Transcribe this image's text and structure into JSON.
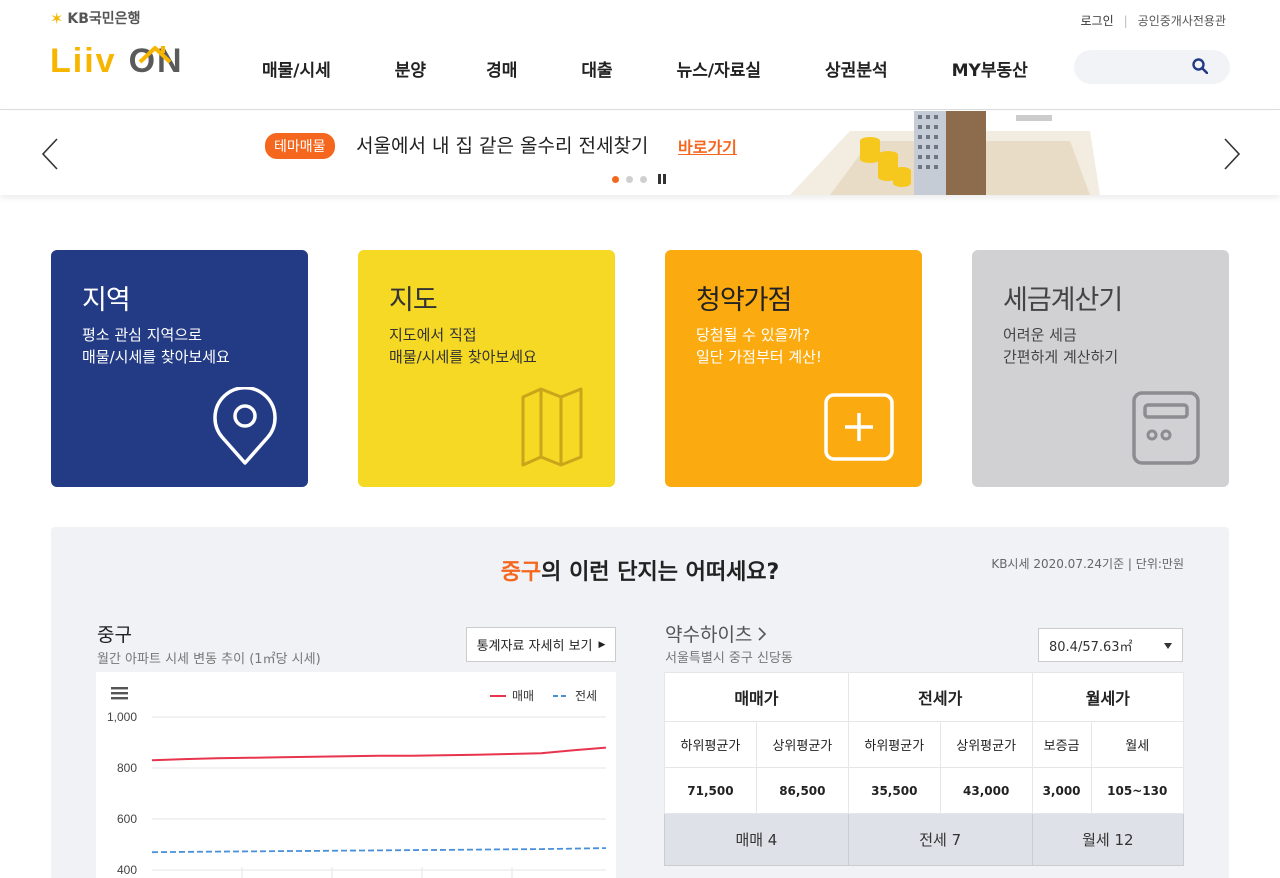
{
  "header": {
    "kb_logo_text": "KB국민은행",
    "logo_word_1": "Liiv",
    "logo_word_2": "ON",
    "login": "로그인",
    "broker_link": "공인중개사전용관",
    "nav": [
      "매물/시세",
      "분양",
      "경매",
      "대출",
      "뉴스/자료실",
      "상권분석",
      "MY부동산"
    ],
    "search_placeholder": ""
  },
  "banner": {
    "badge": "테마매물",
    "text": "서울에서 내 집 같은 올수리 전세찾기",
    "link": "바로가기",
    "active_slide": 1,
    "slide_count": 3
  },
  "cards": [
    {
      "title": "지역",
      "line1": "평소 관심 지역으로",
      "line2": "매물/시세를 찾아보세요",
      "icon": "map-pin-icon"
    },
    {
      "title": "지도",
      "line1": "지도에서 직접",
      "line2": "매물/시세를 찾아보세요",
      "icon": "folded-map-icon"
    },
    {
      "title": "청약가점",
      "line1": "당첨될 수 있을까?",
      "line2": "일단 가점부터 계산!",
      "icon": "plus-square-icon"
    },
    {
      "title": "세금계산기",
      "line1": "어려운 세금",
      "line2": "간편하게 계산하기",
      "icon": "calculator-icon"
    }
  ],
  "section": {
    "title_highlight": "중구",
    "title_rest": "의 이런 단지는 어떠세요?",
    "note": "KB시세 2020.07.24기준 | 단위:만원",
    "region": "중구",
    "region_sub": "월간 아파트 시세 변동 추이 (1㎡당 시세)",
    "stat_button": "통계자료 자세히 보기",
    "apt_name": "약수하이츠",
    "apt_address": "서울특별시 중구 신당동",
    "area_selected": "80.4/57.63㎡",
    "price_table": {
      "groups": [
        "매매가",
        "전세가",
        "월세가"
      ],
      "subheads": [
        "하위평균가",
        "상위평균가",
        "하위평균가",
        "상위평균가",
        "보증금",
        "월세"
      ],
      "values": [
        "71,500",
        "86,500",
        "35,500",
        "43,000",
        "3,000",
        "105~130"
      ],
      "counts": [
        "매매 4",
        "전세 7",
        "월세 12"
      ]
    }
  },
  "chart_data": {
    "type": "line",
    "legend_position": "top-right",
    "series": [
      {
        "name": "매매",
        "color": "#e8344c",
        "style": "solid",
        "values": [
          830,
          835,
          838,
          840,
          842,
          844,
          846,
          848,
          848,
          850,
          852,
          855,
          858,
          870,
          880
        ]
      },
      {
        "name": "전세",
        "color": "#4a90d9",
        "style": "dashed",
        "values": [
          470,
          471,
          472,
          473,
          474,
          475,
          476,
          477,
          478,
          479,
          480,
          481,
          482,
          484,
          486
        ]
      }
    ],
    "y_ticks": [
      "1,000",
      "800",
      "600",
      "400"
    ],
    "y_tick_values": [
      1000,
      800,
      600,
      400
    ],
    "ylim": [
      400,
      1000
    ],
    "grid": true,
    "colors": {
      "accent": "#f5671f",
      "navy": "#233b85"
    }
  }
}
